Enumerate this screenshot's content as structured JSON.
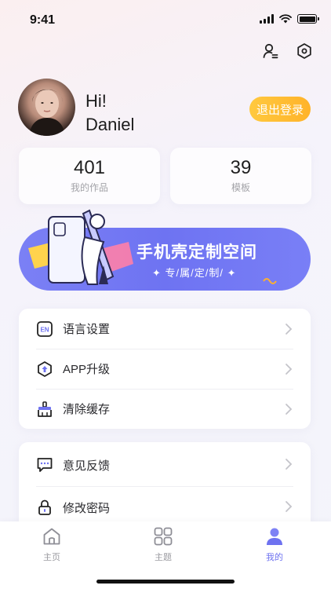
{
  "status_bar": {
    "time": "9:41"
  },
  "profile": {
    "greeting_line1": "Hi!",
    "greeting_line2": "Daniel",
    "logout_label": "退出登录"
  },
  "stats": [
    {
      "value": "401",
      "label": "我的作品"
    },
    {
      "value": "39",
      "label": "模板"
    }
  ],
  "banner": {
    "title": "手机壳定制空间",
    "subtitle": "✦ 专/属/定/制/ ✦"
  },
  "menu_group_1": [
    {
      "label": "语言设置",
      "icon": "language-icon"
    },
    {
      "label": "APP升级",
      "icon": "upgrade-icon"
    },
    {
      "label": "清除缓存",
      "icon": "broom-icon"
    }
  ],
  "menu_group_2": [
    {
      "label": "意见反馈",
      "icon": "feedback-icon"
    },
    {
      "label": "修改密码",
      "icon": "lock-icon"
    }
  ],
  "tabs": [
    {
      "label": "主页",
      "icon": "home-icon"
    },
    {
      "label": "主题",
      "icon": "grid-icon"
    },
    {
      "label": "我的",
      "icon": "user-icon",
      "active": true
    }
  ],
  "colors": {
    "accent": "#6e72f0",
    "logout": "#ffb32a",
    "banner": "#7378f4"
  }
}
